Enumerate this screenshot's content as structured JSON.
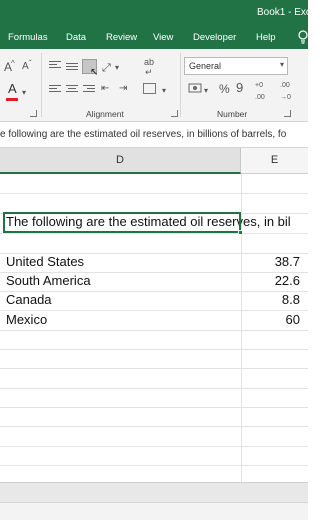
{
  "window": {
    "title": "Book1 - Exc"
  },
  "ribbon_tabs": [
    "Formulas",
    "Data",
    "Review",
    "View",
    "Developer",
    "Help"
  ],
  "ribbon": {
    "font_grow": "A",
    "font_shrink": "A",
    "font_color_label": "A",
    "wrap_label": "ab",
    "alignment_label": "Alignment",
    "number_label": "Number",
    "number_format": "General",
    "percent": "%",
    "comma": "9",
    "inc_decimal": "+0 .00",
    "dec_decimal": ".00 →0"
  },
  "formula_bar": {
    "content": "e following are the estimated oil reserves, in billions of barrels, fo"
  },
  "columns": [
    "D",
    "E"
  ],
  "sheet": {
    "active_cell_text": "The following are the estimated oil reserves, in bil",
    "rows": [
      {
        "label": "United States",
        "value": "38.7"
      },
      {
        "label": "South America",
        "value": "22.6"
      },
      {
        "label": "Canada",
        "value": "8.8"
      },
      {
        "label": "Mexico",
        "value": "60"
      }
    ]
  },
  "colors": {
    "brand": "#217346",
    "ribbon_bg": "#f3f3f3",
    "font_color_underline": "#e02020"
  }
}
